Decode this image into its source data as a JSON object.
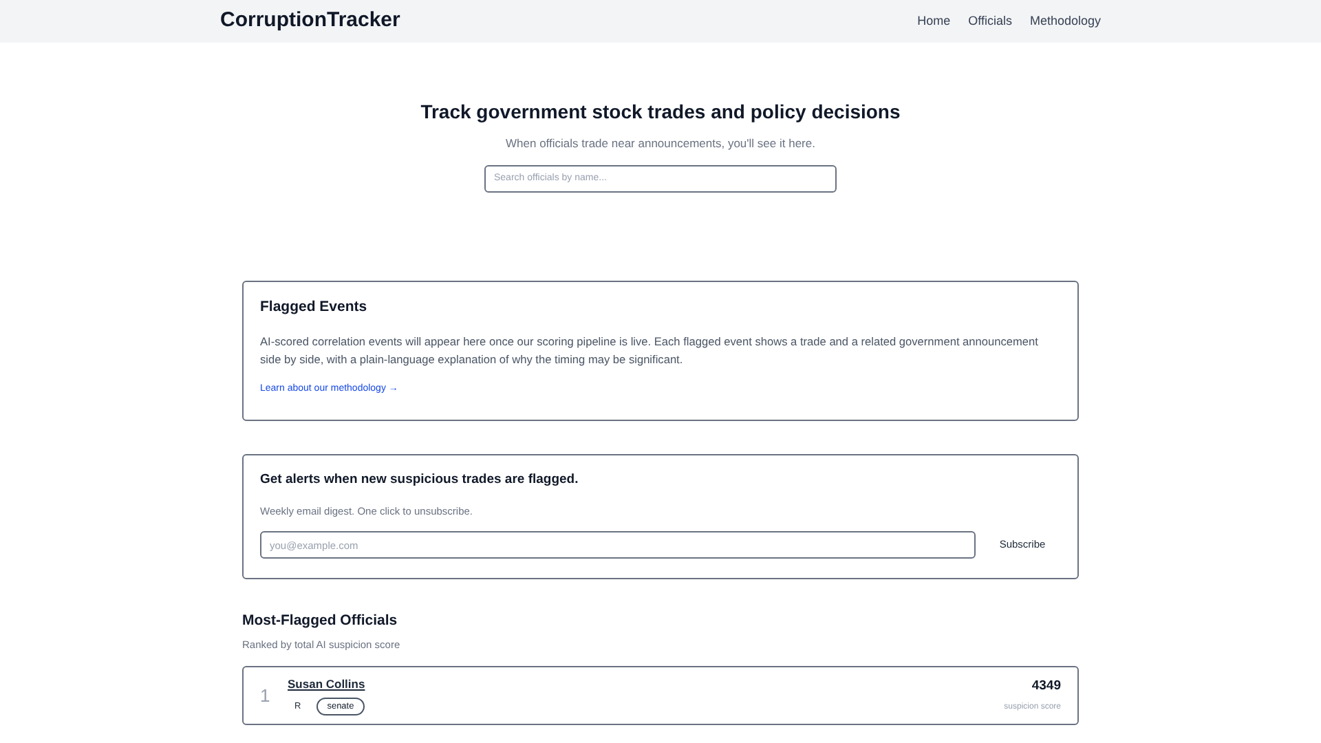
{
  "header": {
    "logo": "CorruptionTracker",
    "nav": [
      {
        "label": "Home"
      },
      {
        "label": "Officials"
      },
      {
        "label": "Methodology"
      }
    ]
  },
  "hero": {
    "title": "Track government stock trades and policy decisions",
    "subtitle": "When officials trade near announcements, you'll see it here.",
    "search": {
      "placeholder": "Search officials by name..."
    }
  },
  "flagged_events": {
    "title": "Flagged Events",
    "body": "AI-scored correlation events will appear here once our scoring pipeline is live. Each flagged event shows a trade and a related government announcement side by side, with a plain-language explanation of why the timing may be significant.",
    "link": "Learn about our methodology →"
  },
  "alerts": {
    "title": "Get alerts when new suspicious trades are flagged.",
    "subtitle": "Weekly email digest. One click to unsubscribe.",
    "email": {
      "placeholder": "you@example.com"
    },
    "button": "Subscribe"
  },
  "officials": {
    "title": "Most-Flagged Officials",
    "subtitle": "Ranked by total AI suspicion score",
    "rows": [
      {
        "rank": "1",
        "name": "Susan Collins",
        "party": "R",
        "chamber": "senate",
        "score": "4349",
        "score_label": "suspicion score"
      }
    ]
  }
}
